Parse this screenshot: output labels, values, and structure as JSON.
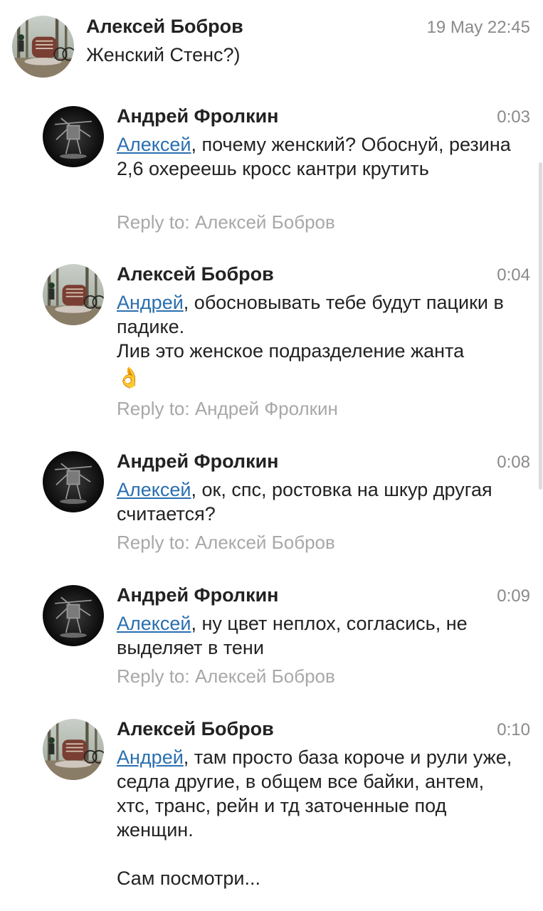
{
  "comments": [
    {
      "author": "Алексей Бобров",
      "time": "19 May 22:45",
      "text": "Женский Стенс?)",
      "avatar": "forest-bike-avatar"
    },
    {
      "author": "Андрей Фролкин",
      "time": "0:03",
      "mention": "Алексей",
      "text": ", почему женский? Обоснуй, резина 2,6 охереешь кросс кантри крутить",
      "reply_to": "Reply to: Алексей Бобров",
      "avatar": "robot-avatar"
    },
    {
      "author": "Алексей Бобров",
      "time": "0:04",
      "mention": "Андрей",
      "text": ", обосновывать тебе будут пацики в падике.\nЛив это женское подразделение жанта",
      "emoji": "👌",
      "reply_to": "Reply to: Андрей Фролкин",
      "avatar": "forest-bike-avatar"
    },
    {
      "author": "Андрей Фролкин",
      "time": "0:08",
      "mention": "Алексей",
      "text": ", ок, спс, ростовка на шкур другая считается?",
      "reply_to": "Reply to: Алексей Бобров",
      "avatar": "robot-avatar"
    },
    {
      "author": "Андрей Фролкин",
      "time": "0:09",
      "mention": "Алексей",
      "text": ", ну цвет неплох, согласись, не выделяет в тени",
      "reply_to": "Reply to: Алексей Бобров",
      "avatar": "robot-avatar"
    },
    {
      "author": "Алексей Бобров",
      "time": "0:10",
      "mention": "Андрей",
      "text": ", там просто база короче и рули уже, седла другие, в общем все байки, антем, хтс, транс, рейн и тд заточенные под женщин.\n\nСам посмотри...",
      "avatar": "forest-bike-avatar"
    }
  ]
}
